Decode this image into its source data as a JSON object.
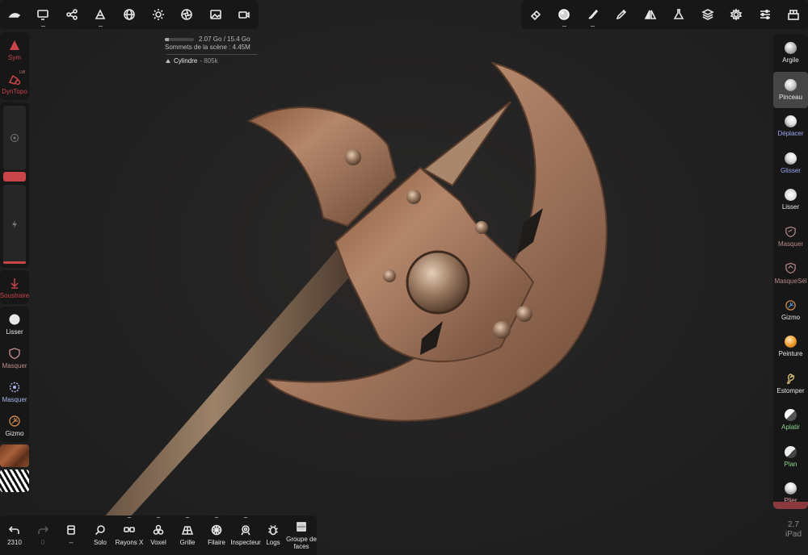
{
  "stats": {
    "memory": "2.07 Go / 15.4 Go",
    "memory_fraction": 0.134,
    "vertices": "Sommets de la scène :  4.45M",
    "mesh_name": "Cylindre",
    "mesh_count": "- 805k"
  },
  "top_left_icons": [
    "sculpt-icon",
    "monitor-icon",
    "share-icon",
    "shape-icon",
    "sphere-grid-icon",
    "sun-icon",
    "aperture-icon",
    "image-icon",
    "camera-icon"
  ],
  "top_right_icons": [
    "eraser-icon",
    "material-ball-icon",
    "brush-icon",
    "pen-icon",
    "mirror-icon",
    "flask-icon",
    "layers-icon",
    "settings-icon",
    "sliders-icon",
    "scene-icon"
  ],
  "left_panel": {
    "lw_label": "LW",
    "sym": "Sym",
    "dyntopo": "DynTopo",
    "subtract": "Soustraire",
    "tools": [
      {
        "label": "Lisser",
        "color": "#e8e8e8"
      },
      {
        "label": "Masquer",
        "color": "#c28a8a"
      },
      {
        "label": "Masquer",
        "color": "#a8b8e8"
      },
      {
        "label": "Gizmo",
        "color": "#e8e8e8"
      }
    ]
  },
  "right_panel": {
    "tools": [
      {
        "label": "Argile",
        "color": "#e8e8e8"
      },
      {
        "label": "Pinceau",
        "color": "#e8e8e8"
      },
      {
        "label": "Déplacer",
        "color": "#9aa8ee"
      },
      {
        "label": "Glisser",
        "color": "#9aa8ee"
      },
      {
        "label": "Lisser",
        "color": "#e8e8e8"
      },
      {
        "label": "Masquer",
        "color": "#b88a8a"
      },
      {
        "label": "MasqueSél",
        "color": "#b88a8a"
      },
      {
        "label": "Gizmo",
        "color": "#e8e8e8"
      },
      {
        "label": "Peinture",
        "color": "#e8e8e8"
      },
      {
        "label": "Estomper",
        "color": "#e8e8e8"
      },
      {
        "label": "Aplatir",
        "color": "#8fd48f"
      },
      {
        "label": "Plan",
        "color": "#8fd48f"
      },
      {
        "label": "Plier",
        "color": "#e8a0a0"
      }
    ]
  },
  "bottom_bar": {
    "undo": "2310",
    "redo": "0",
    "history": "--",
    "solo": "Solo",
    "xray": "Rayons X",
    "voxel": "Voxel",
    "grid": "Grille",
    "wireframe": "Filaire",
    "inspector": "Inspecteur",
    "logs": "Logs",
    "facegroups": "Groupe de faces"
  },
  "version": {
    "number": "2.7",
    "device": "iPad"
  },
  "colors": {
    "accent": "#c8454a",
    "panel": "#171717"
  }
}
